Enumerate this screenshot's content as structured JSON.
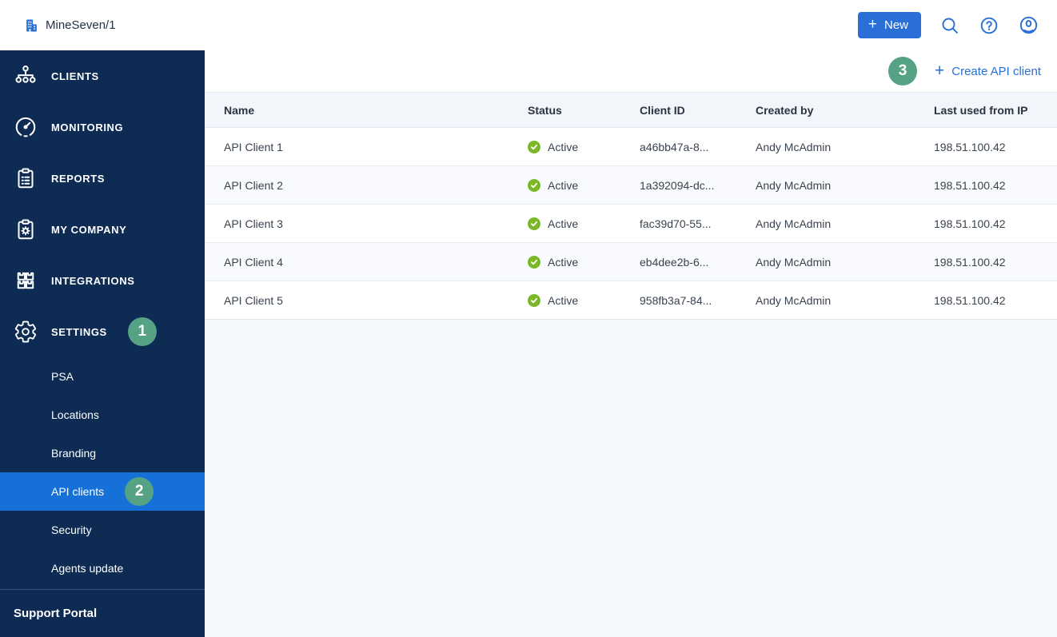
{
  "colors": {
    "accent_blue": "#2a6fd8",
    "sidebar_navy": "#0e2b54",
    "active_item_blue": "#1571d8",
    "badge_green": "#55a384",
    "status_green": "#7cb728"
  },
  "topbar": {
    "org_name": "MineSeven/1",
    "new_button_label": "New"
  },
  "sidebar": {
    "items": [
      {
        "label": "CLIENTS",
        "icon": "org-chart-icon"
      },
      {
        "label": "MONITORING",
        "icon": "gauge-icon"
      },
      {
        "label": "REPORTS",
        "icon": "clipboard-icon"
      },
      {
        "label": "MY COMPANY",
        "icon": "clipboard-gear-icon"
      },
      {
        "label": "INTEGRATIONS",
        "icon": "blocks-icon"
      },
      {
        "label": "SETTINGS",
        "icon": "gear-icon",
        "badge": "1"
      }
    ],
    "settings_subitems": [
      {
        "label": "PSA"
      },
      {
        "label": "Locations"
      },
      {
        "label": "Branding"
      },
      {
        "label": "API clients",
        "badge": "2"
      },
      {
        "label": "Security"
      },
      {
        "label": "Agents update"
      }
    ],
    "footer_label": "Support Portal"
  },
  "main": {
    "create_button": {
      "label": "Create API client",
      "badge": "3"
    },
    "table": {
      "columns": [
        "Name",
        "Status",
        "Client ID",
        "Created by",
        "Last used from IP"
      ],
      "rows": [
        {
          "name": "API Client 1",
          "status": "Active",
          "client_id": "a46bb47a-8...",
          "created_by": "Andy McAdmin",
          "last_used_from_ip": "198.51.100.42"
        },
        {
          "name": "API Client 2",
          "status": "Active",
          "client_id": "1a392094-dc...",
          "created_by": "Andy McAdmin",
          "last_used_from_ip": "198.51.100.42"
        },
        {
          "name": "API Client 3",
          "status": "Active",
          "client_id": "fac39d70-55...",
          "created_by": "Andy McAdmin",
          "last_used_from_ip": "198.51.100.42"
        },
        {
          "name": "API Client 4",
          "status": "Active",
          "client_id": "eb4dee2b-6...",
          "created_by": "Andy McAdmin",
          "last_used_from_ip": "198.51.100.42"
        },
        {
          "name": "API Client 5",
          "status": "Active",
          "client_id": "958fb3a7-84...",
          "created_by": "Andy McAdmin",
          "last_used_from_ip": "198.51.100.42"
        }
      ]
    }
  }
}
